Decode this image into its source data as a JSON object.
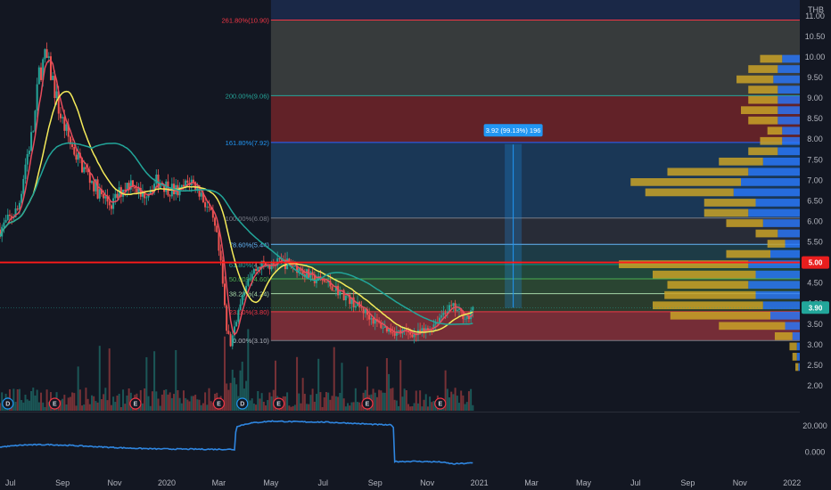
{
  "chart_data": {
    "type": "candlestick",
    "currency": "THB",
    "price_axis": {
      "ticks": [
        "11.00",
        "10.50",
        "10.00",
        "9.50",
        "9.00",
        "8.50",
        "8.00",
        "7.50",
        "7.00",
        "6.50",
        "6.00",
        "5.50",
        "5.00",
        "4.50",
        "4.00",
        "3.50",
        "3.00",
        "2.50",
        "2.00"
      ],
      "ylim": [
        1.5,
        11.3
      ]
    },
    "oscillator_axis": {
      "ticks": [
        "20.000",
        "0.000"
      ],
      "ylim": [
        -15,
        28
      ]
    },
    "time_axis": {
      "labels": [
        "Jul",
        "Sep",
        "Nov",
        "2020",
        "Mar",
        "May",
        "Jul",
        "Sep",
        "Nov",
        "2021",
        "Mar",
        "May",
        "Jul",
        "Sep",
        "Nov",
        "2022"
      ],
      "months_from_jul_2019": [
        0,
        2,
        4,
        6,
        8,
        10,
        12,
        14,
        16,
        18,
        20,
        22,
        24,
        26,
        28,
        30
      ],
      "xlim_months": [
        -0.4,
        30.3
      ]
    },
    "last_bar_month": 17.8,
    "price_keypoints": [
      [
        -0.4,
        5.8
      ],
      [
        0.3,
        6.3
      ],
      [
        0.6,
        7.5
      ],
      [
        0.9,
        8.3
      ],
      [
        1.1,
        9.6
      ],
      [
        1.35,
        10.0
      ],
      [
        1.6,
        9.5
      ],
      [
        1.9,
        8.6
      ],
      [
        2.3,
        7.9
      ],
      [
        2.7,
        7.4
      ],
      [
        3.1,
        7.0
      ],
      [
        3.5,
        6.6
      ],
      [
        3.9,
        6.4
      ],
      [
        4.3,
        6.8
      ],
      [
        4.7,
        7.0
      ],
      [
        5.0,
        6.6
      ],
      [
        5.3,
        6.8
      ],
      [
        5.7,
        7.0
      ],
      [
        6.1,
        6.8
      ],
      [
        6.5,
        6.7
      ],
      [
        6.9,
        7.0
      ],
      [
        7.2,
        6.8
      ],
      [
        7.6,
        6.3
      ],
      [
        7.9,
        5.7
      ],
      [
        8.1,
        4.8
      ],
      [
        8.3,
        3.4
      ],
      [
        8.45,
        3.0
      ],
      [
        8.65,
        3.6
      ],
      [
        8.85,
        4.0
      ],
      [
        9.2,
        4.7
      ],
      [
        9.6,
        4.95
      ],
      [
        10.0,
        4.9
      ],
      [
        10.4,
        5.0
      ],
      [
        10.8,
        4.95
      ],
      [
        11.2,
        4.8
      ],
      [
        11.6,
        4.6
      ],
      [
        12.0,
        4.55
      ],
      [
        12.4,
        4.4
      ],
      [
        12.8,
        4.2
      ],
      [
        13.2,
        4.0
      ],
      [
        13.6,
        3.8
      ],
      [
        14.0,
        3.55
      ],
      [
        14.4,
        3.4
      ],
      [
        14.8,
        3.3
      ],
      [
        15.2,
        3.3
      ],
      [
        15.6,
        3.25
      ],
      [
        16.0,
        3.35
      ],
      [
        16.4,
        3.6
      ],
      [
        16.7,
        3.85
      ],
      [
        17.0,
        3.9
      ],
      [
        17.3,
        3.75
      ],
      [
        17.6,
        3.65
      ],
      [
        17.8,
        3.9
      ]
    ],
    "osc_keypoints": [
      [
        -0.4,
        4.0
      ],
      [
        0.5,
        5.5
      ],
      [
        1.5,
        5.8
      ],
      [
        2.5,
        5.0
      ],
      [
        3.5,
        4.0
      ],
      [
        4.5,
        3.2
      ],
      [
        5.5,
        2.6
      ],
      [
        6.5,
        2.4
      ],
      [
        7.5,
        2.3
      ],
      [
        8.5,
        2.2
      ],
      [
        8.62,
        2.0
      ],
      [
        8.66,
        19.5
      ],
      [
        9.2,
        22.0
      ],
      [
        10.0,
        23.5
      ],
      [
        11.0,
        23.0
      ],
      [
        12.0,
        22.8
      ],
      [
        13.0,
        22.0
      ],
      [
        14.0,
        21.0
      ],
      [
        14.6,
        20.5
      ],
      [
        14.7,
        19.0
      ],
      [
        14.72,
        -7.0
      ],
      [
        15.5,
        -6.8
      ],
      [
        16.5,
        -7.3
      ],
      [
        17.0,
        -8.8
      ],
      [
        17.8,
        -8.0
      ]
    ],
    "series": [
      {
        "name": "",
        "type": "ma-fast",
        "color": "#e74c5c"
      },
      {
        "name": "",
        "type": "ma-mid",
        "color": "#f5eb5a"
      },
      {
        "name": "",
        "type": "ma-slow",
        "color": "#22a69a"
      }
    ],
    "fibonacci": {
      "start_month": 10.0,
      "end_month": 30.3,
      "levels": [
        {
          "label": "0.00%(3.10)",
          "price": 3.1,
          "color": "#787b86",
          "fill": "#81303a"
        },
        {
          "label": "23.60%(3.80)",
          "price": 3.8,
          "color": "#f23645",
          "fill": "#2c3f2d"
        },
        {
          "label": "38.20%(4.24)",
          "price": 4.24,
          "color": "#a5d6a7",
          "fill": "#2d4a34"
        },
        {
          "label": "50.00%(4.60)",
          "price": 4.6,
          "color": "#4caf50",
          "fill": "#244d3e"
        },
        {
          "label": "61.80%(4.95)",
          "price": 4.95,
          "color": "#089981",
          "fill": "#1f3f4a"
        },
        {
          "label": "78.60%(5.44)",
          "price": 5.44,
          "color": "#64b5f6",
          "fill": "#2b2f3a"
        },
        {
          "label": "100.00%(6.08)",
          "price": 6.08,
          "color": "#787b86",
          "fill": "#1c3b5c"
        },
        {
          "label": "161.80%(7.92)",
          "price": 7.92,
          "color": "#2962ff",
          "fill": "#6b2429"
        },
        {
          "label": "200.00%(9.06)",
          "price": 9.06,
          "color": "#26a69a",
          "fill": "#3c3f3f"
        },
        {
          "label": "261.80%(10.90)",
          "price": 10.9,
          "color": "#f23645",
          "fill": "#1f3256"
        }
      ],
      "label_colors": [
        "#b2b5be",
        "#f23645",
        "#a5d6a7",
        "#4caf50",
        "#26a69a",
        "#64b5f6",
        "#787b86",
        "#2196f3",
        "#26a69a",
        "#f23645"
      ]
    },
    "horizontal_line": {
      "price": 5.0,
      "label": "5.00",
      "color": "#ff1a1a"
    },
    "last_price": {
      "price": 3.9,
      "label": "3.90",
      "color": "#22a69a"
    },
    "measure": {
      "label": "3.92 (99.13%) 196",
      "from_price": 3.9,
      "to_price": 7.87,
      "month": 19.3,
      "color": "#2196f3"
    },
    "event_markers": [
      {
        "month": -0.1,
        "letter": "D",
        "color": "#2196f3"
      },
      {
        "month": 1.7,
        "letter": "E",
        "color": "#f23645"
      },
      {
        "month": 4.8,
        "letter": "E",
        "color": "#f23645"
      },
      {
        "month": 8.0,
        "letter": "E",
        "color": "#f23645"
      },
      {
        "month": 8.9,
        "letter": "D",
        "color": "#2196f3"
      },
      {
        "month": 10.3,
        "letter": "E",
        "color": "#f23645"
      },
      {
        "month": 13.7,
        "letter": "E",
        "color": "#f23645"
      },
      {
        "month": 16.5,
        "letter": "E",
        "color": "#f23645"
      }
    ],
    "volume_profile": {
      "bands": [
        {
          "price": 2.45,
          "yellow": 0.02,
          "blue": 0.01
        },
        {
          "price": 2.7,
          "yellow": 0.03,
          "blue": 0.02
        },
        {
          "price": 2.95,
          "yellow": 0.05,
          "blue": 0.02
        },
        {
          "price": 3.2,
          "yellow": 0.12,
          "blue": 0.05
        },
        {
          "price": 3.45,
          "yellow": 0.45,
          "blue": 0.1
        },
        {
          "price": 3.7,
          "yellow": 0.68,
          "blue": 0.2
        },
        {
          "price": 3.95,
          "yellow": 0.75,
          "blue": 0.25
        },
        {
          "price": 4.2,
          "yellow": 0.62,
          "blue": 0.3
        },
        {
          "price": 4.45,
          "yellow": 0.55,
          "blue": 0.35
        },
        {
          "price": 4.7,
          "yellow": 0.7,
          "blue": 0.3
        },
        {
          "price": 4.95,
          "yellow": 0.88,
          "blue": 0.35
        },
        {
          "price": 5.2,
          "yellow": 0.3,
          "blue": 0.2
        },
        {
          "price": 5.45,
          "yellow": 0.12,
          "blue": 0.1
        },
        {
          "price": 5.7,
          "yellow": 0.15,
          "blue": 0.15
        },
        {
          "price": 5.95,
          "yellow": 0.25,
          "blue": 0.25
        },
        {
          "price": 6.2,
          "yellow": 0.3,
          "blue": 0.35
        },
        {
          "price": 6.45,
          "yellow": 0.35,
          "blue": 0.3
        },
        {
          "price": 6.7,
          "yellow": 0.6,
          "blue": 0.45
        },
        {
          "price": 6.95,
          "yellow": 0.75,
          "blue": 0.4
        },
        {
          "price": 7.2,
          "yellow": 0.55,
          "blue": 0.35
        },
        {
          "price": 7.45,
          "yellow": 0.3,
          "blue": 0.25
        },
        {
          "price": 7.7,
          "yellow": 0.2,
          "blue": 0.15
        },
        {
          "price": 7.95,
          "yellow": 0.15,
          "blue": 0.12
        },
        {
          "price": 8.2,
          "yellow": 0.1,
          "blue": 0.12
        },
        {
          "price": 8.45,
          "yellow": 0.2,
          "blue": 0.15
        },
        {
          "price": 8.7,
          "yellow": 0.25,
          "blue": 0.15
        },
        {
          "price": 8.95,
          "yellow": 0.2,
          "blue": 0.15
        },
        {
          "price": 9.2,
          "yellow": 0.2,
          "blue": 0.15
        },
        {
          "price": 9.45,
          "yellow": 0.25,
          "blue": 0.18
        },
        {
          "price": 9.7,
          "yellow": 0.2,
          "blue": 0.15
        },
        {
          "price": 9.95,
          "yellow": 0.15,
          "blue": 0.12
        }
      ]
    },
    "colors": {
      "background": "#131722",
      "up": "#26a69a",
      "down": "#ef5350",
      "oscillator": "#2f86e0",
      "axis_text": "#b2b5be",
      "profile_yellow": "#c9a227",
      "profile_blue": "#2979ff"
    }
  }
}
